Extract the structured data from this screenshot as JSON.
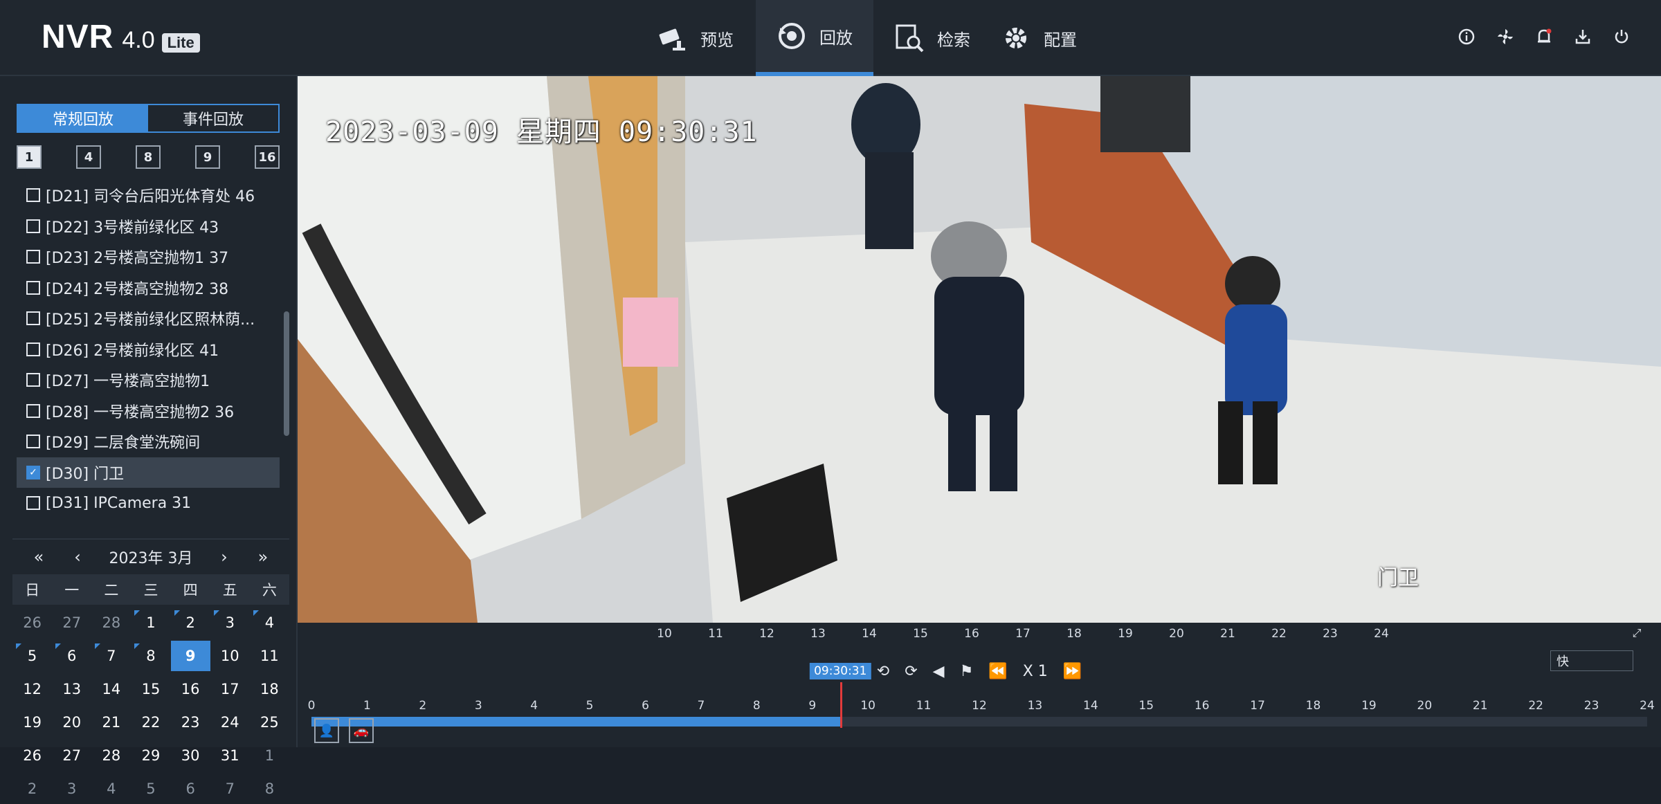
{
  "header": {
    "logo_main": "NVR",
    "logo_version": "4.0",
    "logo_badge": "Lite",
    "nav": [
      {
        "label": "预览",
        "icon": "camera-icon"
      },
      {
        "label": "回放",
        "icon": "playback-icon"
      },
      {
        "label": "检索",
        "icon": "search-doc-icon"
      },
      {
        "label": "配置",
        "icon": "gear-icon"
      }
    ],
    "active_nav": "回放"
  },
  "sidebar": {
    "mode_tabs": [
      "常规回放",
      "事件回放"
    ],
    "split_options": [
      "1",
      "4",
      "8",
      "9",
      "16"
    ],
    "cameras": [
      {
        "label": "[D21] 司令台后阳光体育处  46",
        "checked": false
      },
      {
        "label": "[D22] 3号楼前绿化区  43",
        "checked": false
      },
      {
        "label": "[D23] 2号楼高空抛物1  37",
        "checked": false
      },
      {
        "label": "[D24] 2号楼高空抛物2  38",
        "checked": false
      },
      {
        "label": "[D25] 2号楼前绿化区照林荫...",
        "checked": false
      },
      {
        "label": "[D26] 2号楼前绿化区  41",
        "checked": false
      },
      {
        "label": "[D27] 一号楼高空抛物1",
        "checked": false
      },
      {
        "label": "[D28] 一号楼高空抛物2  36",
        "checked": false
      },
      {
        "label": "[D29] 二层食堂洗碗间",
        "checked": false
      },
      {
        "label": "[D30] 门卫",
        "checked": true
      },
      {
        "label": "[D31] IPCamera 31",
        "checked": false
      }
    ]
  },
  "calendar": {
    "title": "2023年 3月",
    "nav_prev_year": "«",
    "nav_prev_month": "‹",
    "nav_next_month": "›",
    "nav_next_year": "»",
    "weekdays": [
      "日",
      "一",
      "二",
      "三",
      "四",
      "五",
      "六"
    ],
    "days": [
      {
        "d": "26",
        "other": true
      },
      {
        "d": "27",
        "other": true
      },
      {
        "d": "28",
        "other": true
      },
      {
        "d": "1",
        "rec": true
      },
      {
        "d": "2",
        "rec": true
      },
      {
        "d": "3",
        "rec": true
      },
      {
        "d": "4",
        "rec": true
      },
      {
        "d": "5",
        "rec": true
      },
      {
        "d": "6",
        "rec": true
      },
      {
        "d": "7",
        "rec": true
      },
      {
        "d": "8",
        "rec": true
      },
      {
        "d": "9",
        "today": true
      },
      {
        "d": "10"
      },
      {
        "d": "11"
      },
      {
        "d": "12"
      },
      {
        "d": "13"
      },
      {
        "d": "14"
      },
      {
        "d": "15"
      },
      {
        "d": "16"
      },
      {
        "d": "17"
      },
      {
        "d": "18"
      },
      {
        "d": "19"
      },
      {
        "d": "20"
      },
      {
        "d": "21"
      },
      {
        "d": "22"
      },
      {
        "d": "23"
      },
      {
        "d": "24"
      },
      {
        "d": "25"
      },
      {
        "d": "26"
      },
      {
        "d": "27"
      },
      {
        "d": "28"
      },
      {
        "d": "29"
      },
      {
        "d": "30"
      },
      {
        "d": "31"
      },
      {
        "d": "1",
        "other": true
      },
      {
        "d": "2",
        "other": true
      },
      {
        "d": "3",
        "other": true
      },
      {
        "d": "4",
        "other": true
      },
      {
        "d": "5",
        "other": true
      },
      {
        "d": "6",
        "other": true
      },
      {
        "d": "7",
        "other": true
      },
      {
        "d": "8",
        "other": true
      }
    ]
  },
  "video": {
    "osd_time": "2023-03-09 星期四 09:30:31",
    "osd_label": "门卫"
  },
  "timeline": {
    "hours_top": [
      "10",
      "11",
      "12",
      "13",
      "14",
      "15",
      "16",
      "17",
      "18",
      "19",
      "20",
      "21",
      "22",
      "23",
      "24"
    ],
    "hours_bottom": [
      "0",
      "1",
      "2",
      "3",
      "4",
      "5",
      "6",
      "7",
      "8",
      "9",
      "10",
      "11",
      "12",
      "13",
      "14",
      "15",
      "16",
      "17",
      "18",
      "19",
      "20",
      "21",
      "22",
      "23",
      "24"
    ],
    "cursor_time": "09:30:31",
    "cursor_fraction": 0.396,
    "recorded_until_fraction": 0.396,
    "speed": "X 1",
    "speed_select": "快"
  },
  "colors": {
    "accent": "#3d8ad8",
    "cursor": "#e23b3b",
    "panel": "#1f262e"
  }
}
